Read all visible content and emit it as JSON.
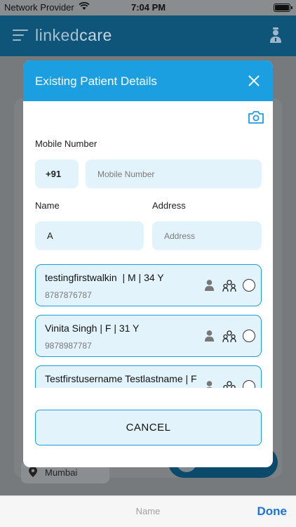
{
  "status_bar": {
    "carrier": "Network Provider",
    "time": "7:04 PM"
  },
  "app_bar": {
    "logo_light": "linked",
    "logo_bold": "care"
  },
  "background": {
    "city": "Mumbai"
  },
  "modal": {
    "title": "Existing Patient Details",
    "mobile_label": "Mobile Number",
    "country_code": "+91",
    "mobile_placeholder": "Mobile Number",
    "name_label": "Name",
    "name_value": "A",
    "address_label": "Address",
    "address_placeholder": "Address",
    "patients": [
      {
        "title": "testingfirstwalkin  | M | 34 Y",
        "phone": "8787876787"
      },
      {
        "title": "Vinita Singh | F | 31 Y",
        "phone": "9878987787"
      },
      {
        "title": "Testfirstusername Testlastname | F",
        "phone": ""
      }
    ],
    "cancel_label": "CANCEL"
  },
  "keyboard_accessory": {
    "field_name": "Name",
    "done_label": "Done"
  },
  "colors": {
    "accent": "#1b9fe0",
    "field_bg": "#e3f3fc",
    "done": "#1a73d9"
  }
}
